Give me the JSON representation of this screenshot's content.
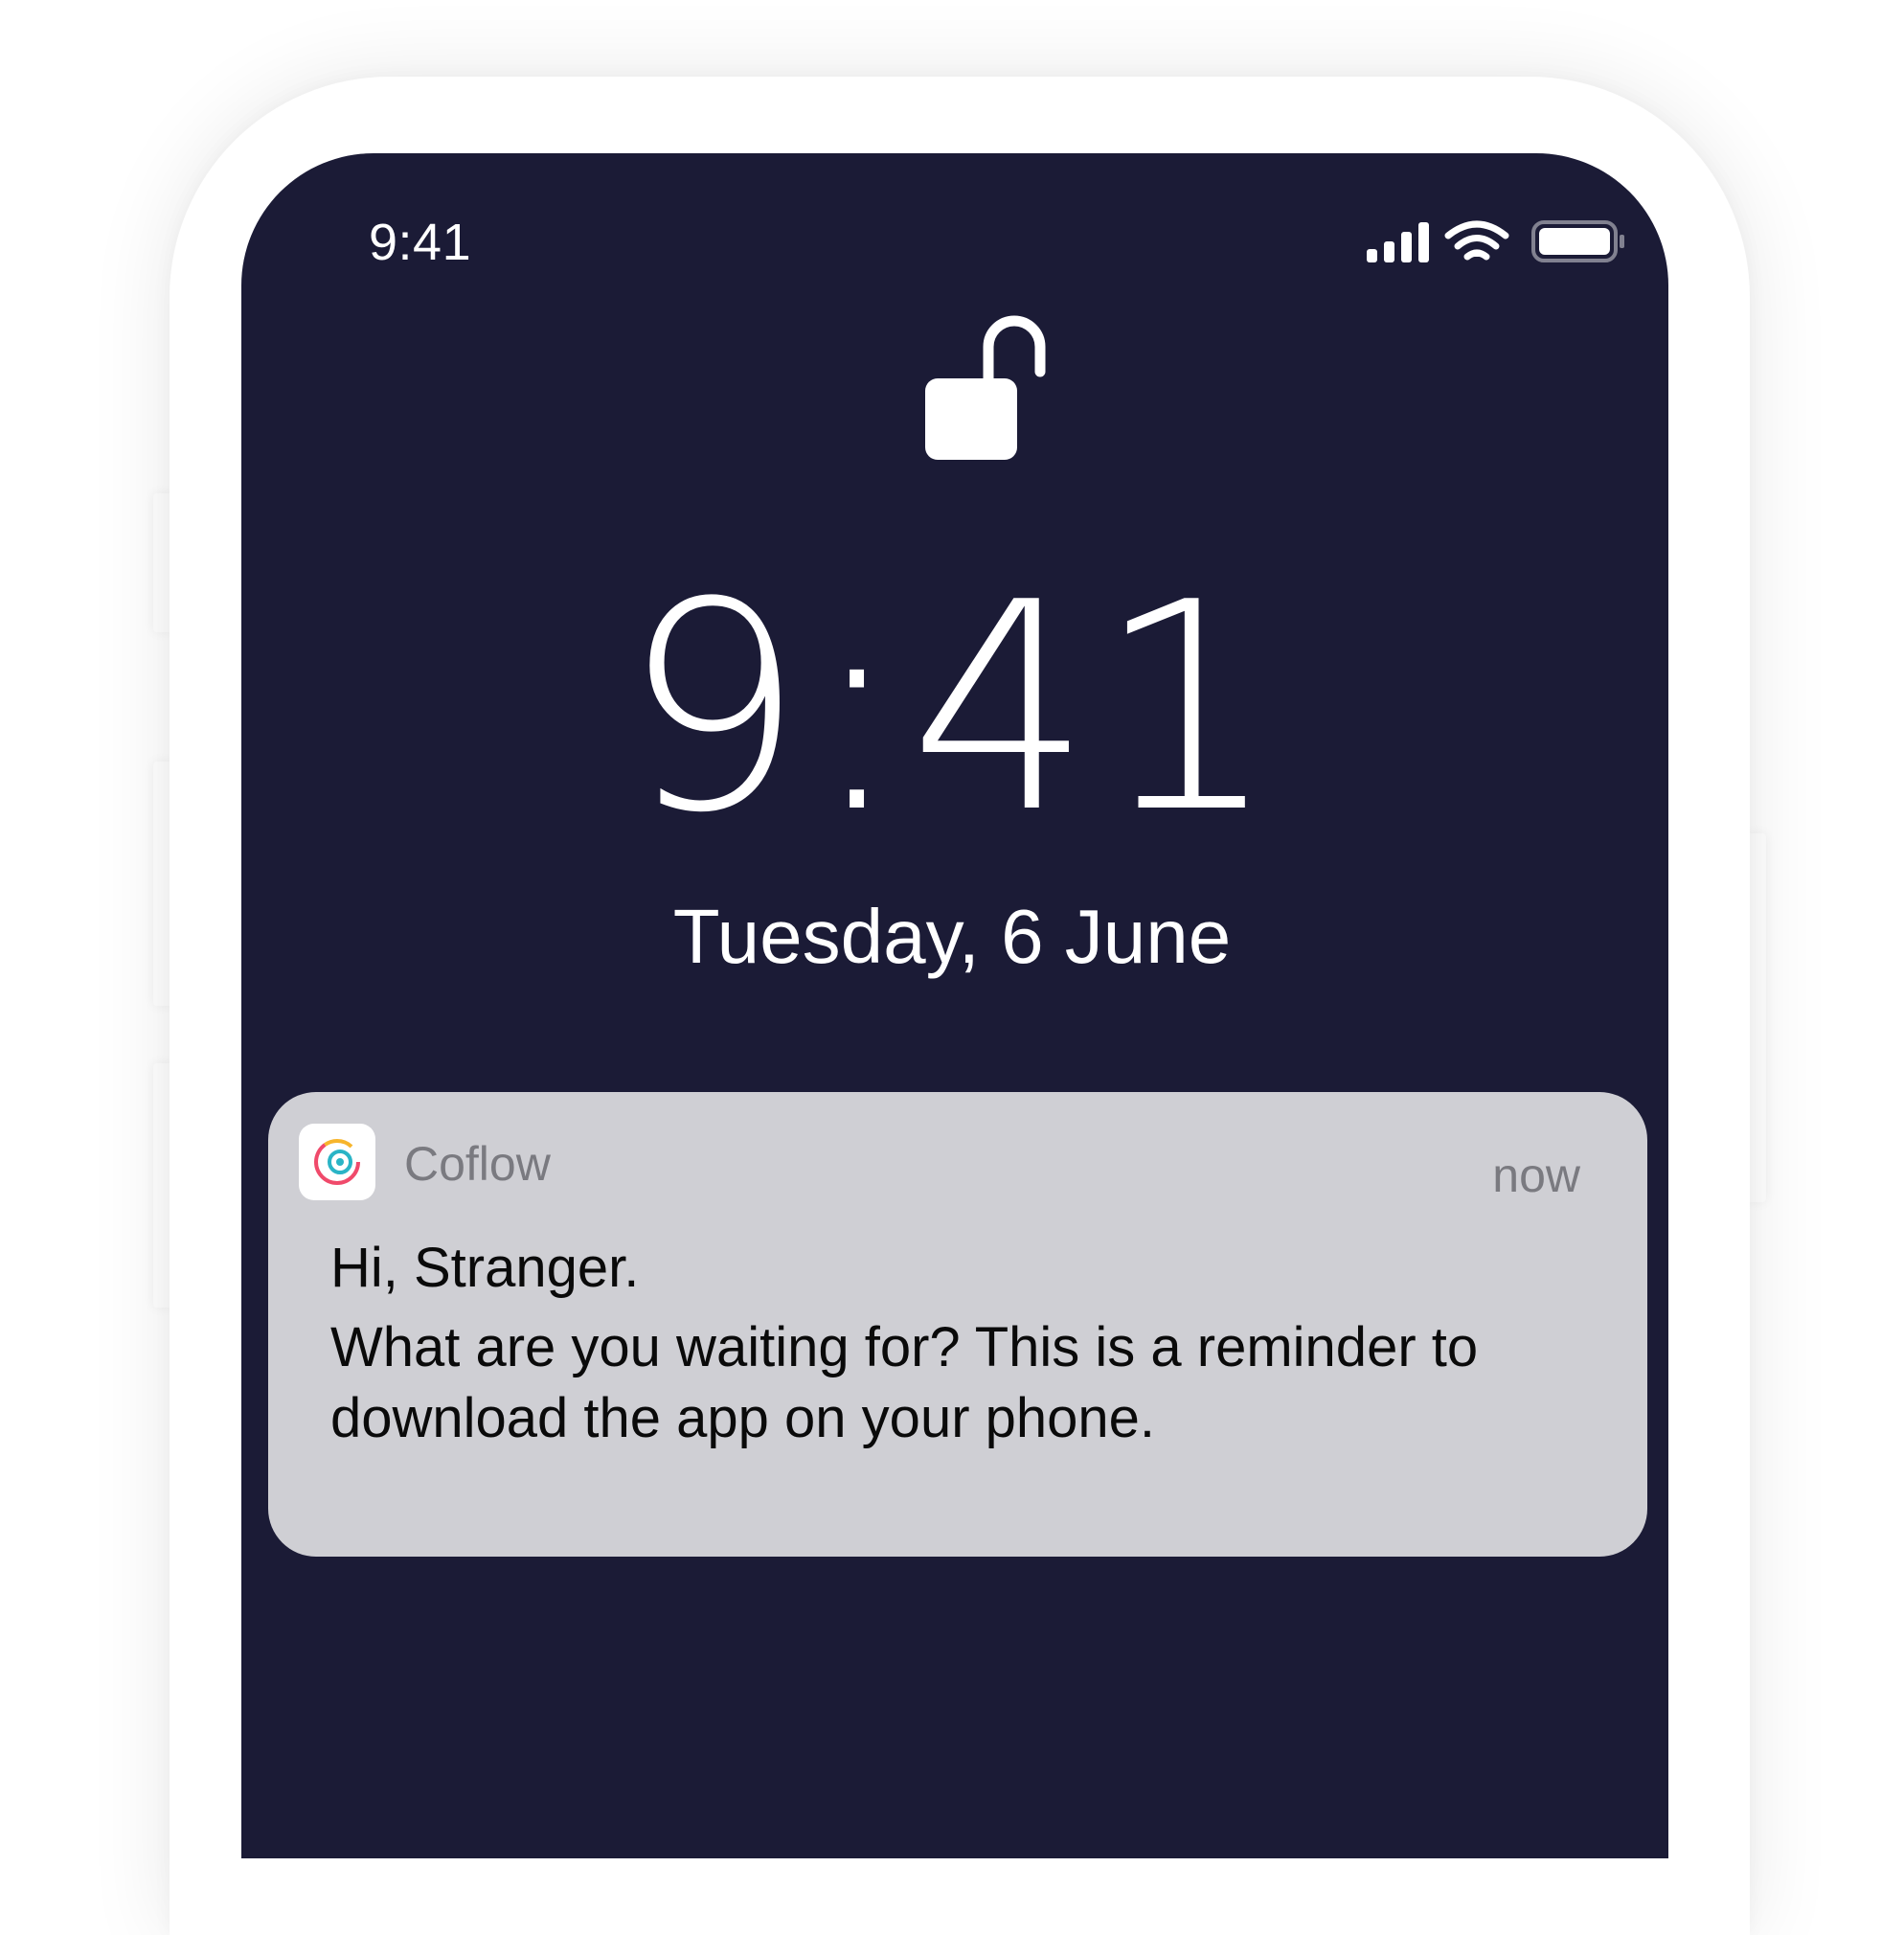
{
  "status_bar": {
    "time": "9:41",
    "icons": [
      "cellular-signal-icon",
      "wifi-icon",
      "battery-icon"
    ]
  },
  "lock_screen": {
    "lock_icon": "unlocked-padlock-icon",
    "clock": "9:41",
    "date": "Tuesday, 6 June"
  },
  "notification": {
    "app_icon": "coflow-app-icon",
    "app_name": "Coflow",
    "time": "now",
    "title": "Hi, Stranger.",
    "body": "What are you waiting for? This is a reminder to download the app on your phone."
  },
  "colors": {
    "screen_background": "#1b1b36",
    "notification_background": "#cfcfd4",
    "text_primary": "#ffffff"
  }
}
